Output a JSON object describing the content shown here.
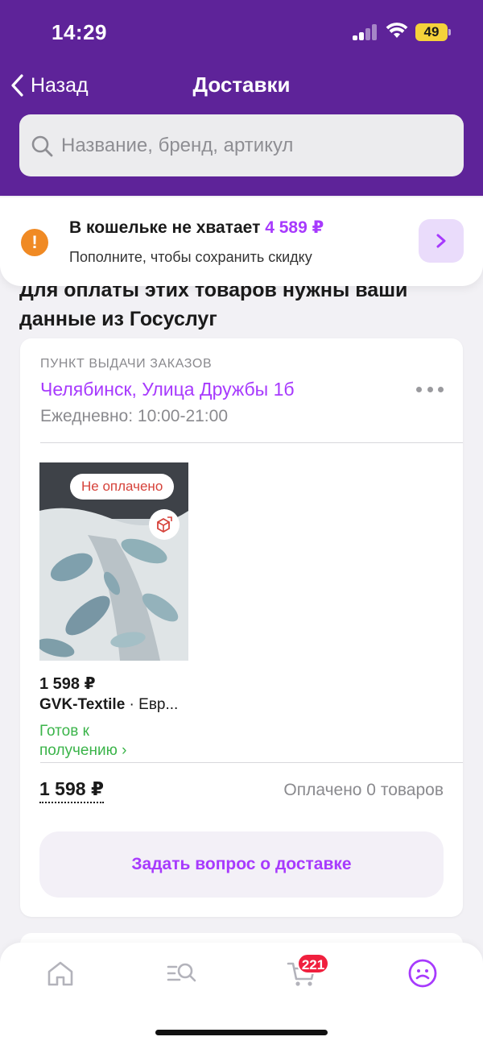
{
  "status_bar": {
    "time": "14:29",
    "battery": "49"
  },
  "nav": {
    "back_label": "Назад",
    "title": "Доставки"
  },
  "search": {
    "placeholder": "Название, бренд, артикул",
    "value": ""
  },
  "wallet_banner": {
    "title": "В кошельке не хватает",
    "amount": "4 589 ₽",
    "subtitle": "Пополните, чтобы сохранить скидку",
    "warning_icon": "!"
  },
  "gosuslugi_notice": "Для оплаты этих товаров нужны ваши данные из Госуслуг",
  "pickup": {
    "label": "ПУНКТ ВЫДАЧИ ЗАКАЗОВ",
    "address": "Челябинск, Улица Дружбы 1б",
    "hours": "Ежедневно: 10:00-21:00"
  },
  "product": {
    "badge": "Не оплачено",
    "price": "1 598 ₽",
    "brand": "GVK-Textile",
    "name_suffix": " · Евр...",
    "status": "Готов к получению ›"
  },
  "summary": {
    "total": "1 598 ₽",
    "paid_count": "Оплачено 0 товаров"
  },
  "actions": {
    "ask_delivery": "Задать вопрос о доставке"
  },
  "tabbar": {
    "cart_count": "221",
    "icons": [
      "home-icon",
      "catalog-search-icon",
      "cart-icon",
      "profile-icon"
    ],
    "active_color": "#a73afd"
  },
  "colors": {
    "header": "#5e2399",
    "accent": "#a73afd",
    "warning": "#f08a24",
    "ready": "#3bb44a",
    "unpaid": "#d6423a"
  }
}
